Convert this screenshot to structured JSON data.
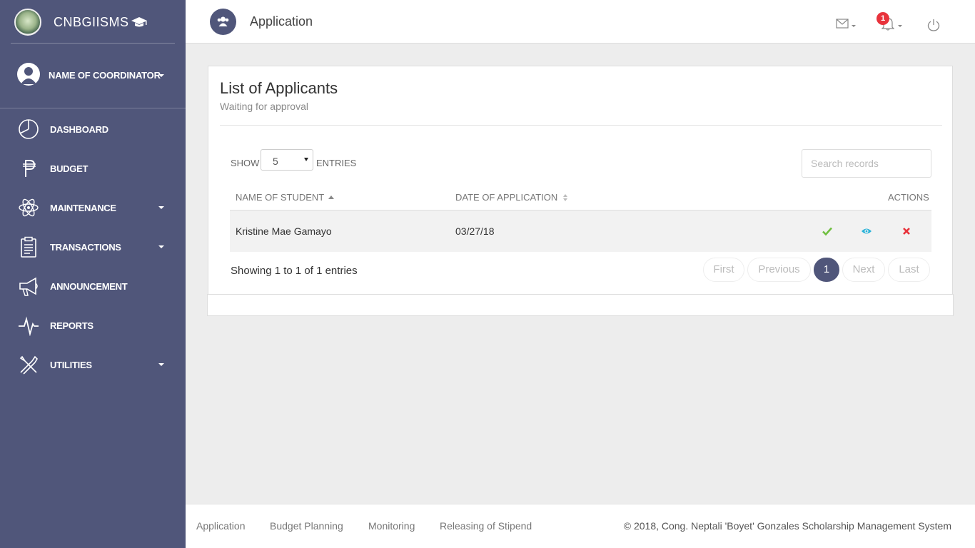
{
  "brand": {
    "title": "CNBGIISMS"
  },
  "user": {
    "name": "NAME OF COORDINATOR"
  },
  "sidebar": {
    "items": [
      {
        "label": "DASHBOARD"
      },
      {
        "label": "BUDGET"
      },
      {
        "label": "MAINTENANCE"
      },
      {
        "label": "TRANSACTIONS"
      },
      {
        "label": "ANNOUNCEMENT"
      },
      {
        "label": "REPORTS"
      },
      {
        "label": "UTILITIES"
      }
    ]
  },
  "header": {
    "title": "Application",
    "notification_count": "1"
  },
  "card": {
    "title": "List of Applicants",
    "subtitle": "Waiting for approval",
    "show_label": "SHOW",
    "entries_value": "5",
    "entries_label": "ENTRIES",
    "search_placeholder": "Search records",
    "columns": [
      "NAME OF STUDENT",
      "DATE OF APPLICATION",
      "ACTIONS"
    ],
    "rows": [
      {
        "name": "Kristine Mae Gamayo",
        "date": "03/27/18"
      }
    ],
    "info": "Showing 1 to 1 of 1 entries",
    "pagination": {
      "first": "First",
      "previous": "Previous",
      "current": "1",
      "next": "Next",
      "last": "Last"
    }
  },
  "footer": {
    "links": [
      "Application",
      "Budget Planning",
      "Monitoring",
      "Releasing of Stipend"
    ],
    "copyright": "© 2018, Cong. Neptali 'Boyet' Gonzales Scholarship Management System"
  },
  "colors": {
    "sidebar": "#50567a",
    "approve": "#6fbf3f",
    "view": "#2bb3d9",
    "reject": "#e8333c",
    "badge": "#e8333c"
  }
}
